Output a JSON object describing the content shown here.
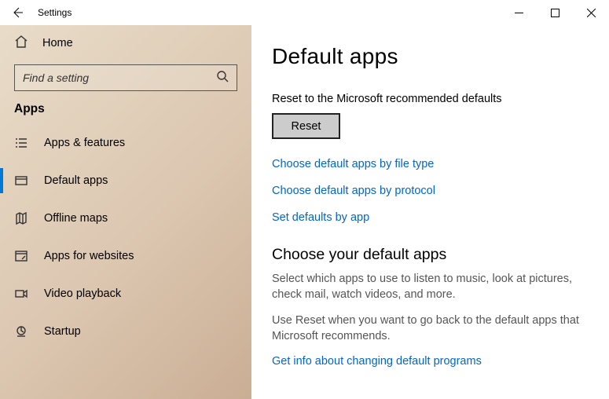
{
  "window": {
    "title": "Settings"
  },
  "sidebar": {
    "home": "Home",
    "search_placeholder": "Find a setting",
    "section": "Apps",
    "items": [
      {
        "label": "Apps & features"
      },
      {
        "label": "Default apps"
      },
      {
        "label": "Offline maps"
      },
      {
        "label": "Apps for websites"
      },
      {
        "label": "Video playback"
      },
      {
        "label": "Startup"
      }
    ]
  },
  "content": {
    "page_title": "Default apps",
    "reset_label": "Reset to the Microsoft recommended defaults",
    "reset_btn": "Reset",
    "link_filetype": "Choose default apps by file type",
    "link_protocol": "Choose default apps by protocol",
    "link_byapp": "Set defaults by app",
    "choose_hdr": "Choose your default apps",
    "choose_p1": "Select which apps to use to listen to music, look at pictures, check mail, watch videos, and more.",
    "choose_p2": "Use Reset when you want to go back to the default apps that Microsoft recommends.",
    "info_link": "Get info about changing default programs"
  }
}
